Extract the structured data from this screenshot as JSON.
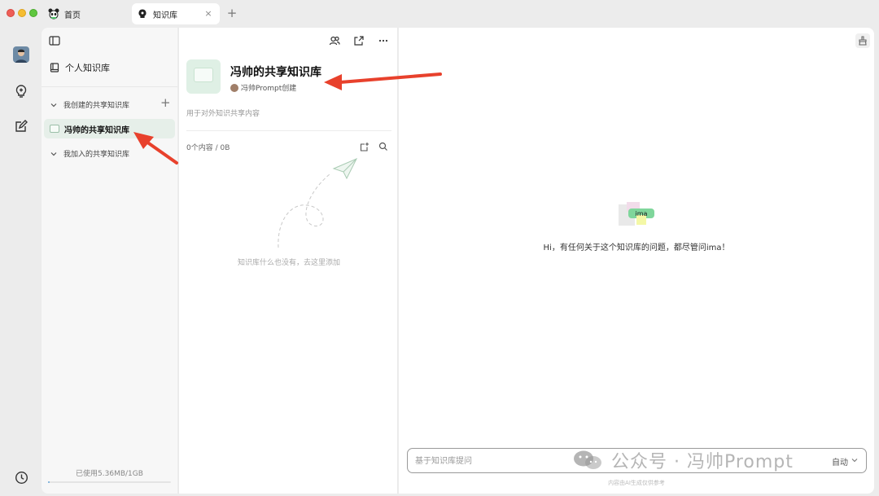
{
  "tabs": [
    {
      "label": "首页",
      "icon": "panda-icon"
    },
    {
      "label": "知识库",
      "icon": "bulb-icon",
      "close": "×"
    }
  ],
  "tab_add": "+",
  "sidebar": {
    "personal_label": "个人知识库",
    "created_section": "我创建的共享知识库",
    "created_add": "+",
    "created_items": [
      {
        "label": "冯帅的共享知识库"
      }
    ],
    "joined_section": "我加入的共享知识库",
    "usage_text": "已使用5.36MB/1GB",
    "usage_fraction": 0.005
  },
  "knowledge_base": {
    "title": "冯帅的共享知识库",
    "creator": "冯帅Prompt创建",
    "description": "用于对外知识共享内容",
    "stats": "0个内容 / 0B",
    "empty_text": "知识库什么也没有，去这里添加"
  },
  "chat": {
    "logo_text": "ima",
    "greeting": "Hi，有任何关于这个知识库的问题，都尽管问ima！",
    "input_placeholder": "基于知识库提问",
    "model_label": "自动",
    "disclaimer": "内容由AI生成仅供参考"
  },
  "watermark": "公众号 · 冯帅Prompt",
  "colors": {
    "accent_green": "#dff0e5",
    "annotation_red": "#e8412c"
  }
}
